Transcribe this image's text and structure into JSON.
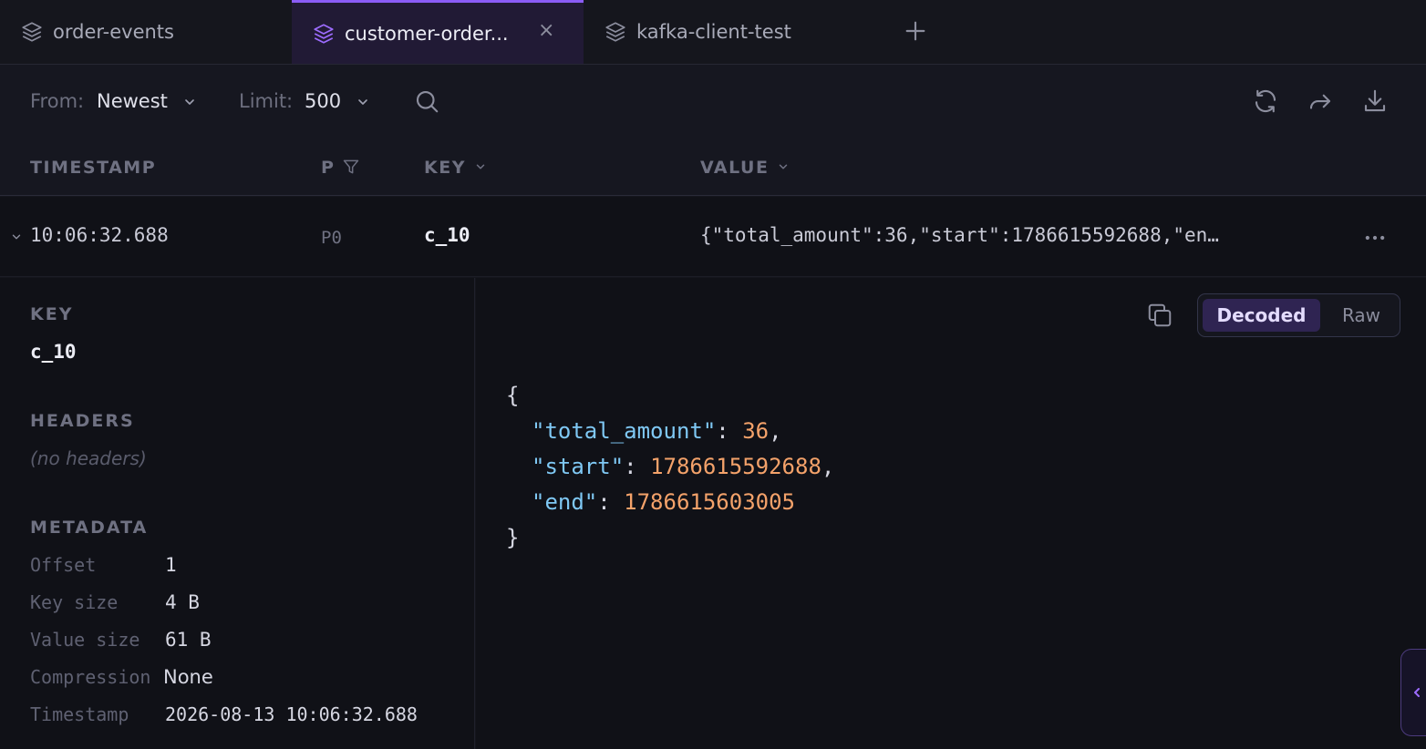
{
  "tabs": [
    {
      "label": "order-events",
      "icon": "layers-icon"
    },
    {
      "label": "customer-order...",
      "icon": "layers-icon",
      "active": true
    },
    {
      "label": "kafka-client-test",
      "icon": "layers-icon"
    }
  ],
  "tab_close_glyph": "×",
  "toolbar": {
    "from_label": "From:",
    "from_value": "Newest",
    "limit_label": "Limit:",
    "limit_value": "500",
    "icons": [
      "search-icon",
      "refresh-icon",
      "share-icon",
      "download-icon"
    ]
  },
  "columns": {
    "timestamp": "TIMESTAMP",
    "partition": "P",
    "key": "KEY",
    "value": "VALUE"
  },
  "row": {
    "timestamp": "10:06:32.688",
    "partition": "P0",
    "key": "c_10",
    "value": "{\"total_amount\":36,\"start\":1786615592688,\"en…"
  },
  "detail": {
    "key_title": "KEY",
    "key_value": "c_10",
    "headers_title": "HEADERS",
    "headers_empty": "(no headers)",
    "metadata_title": "METADATA",
    "metadata": [
      {
        "label": "Offset",
        "value": "1"
      },
      {
        "label": "Key size",
        "value": "4 B"
      },
      {
        "label": "Value size",
        "value": "61 B"
      },
      {
        "label": "Compression",
        "value": "None"
      },
      {
        "label": "Timestamp",
        "value": "2026-08-13 10:06:32.688"
      }
    ],
    "view_modes": {
      "decoded": "Decoded",
      "raw": "Raw"
    },
    "json": {
      "open": "{",
      "close": "}",
      "entries": [
        {
          "key": "\"total_amount\"",
          "value": "36",
          "sep": ","
        },
        {
          "key": "\"start\"",
          "value": "1786615592688",
          "sep": ","
        },
        {
          "key": "\"end\"",
          "value": "1786615603005",
          "sep": ""
        }
      ]
    }
  },
  "colors": {
    "accent": "#8b5cf6",
    "json_key": "#7fc8f4",
    "json_number": "#f4a26a"
  }
}
